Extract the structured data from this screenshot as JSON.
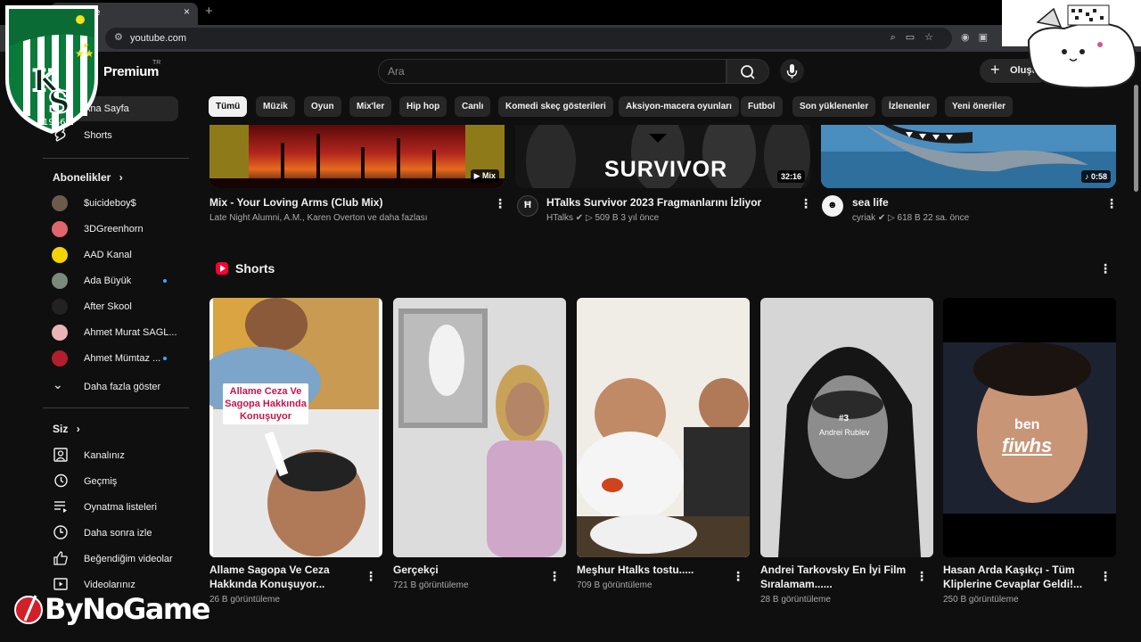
{
  "browser": {
    "tab_title": "ube",
    "tab_close": "×",
    "new_tab": "+",
    "url": "youtube.com",
    "menu": "⋮"
  },
  "header": {
    "brand_suffix": "Premium",
    "brand_tm": "TR",
    "search_placeholder": "Ara",
    "create_label": "Oluştur"
  },
  "sidebar": {
    "home": "Ana Sayfa",
    "shorts": "Shorts",
    "subscriptions_title": "Abonelikler",
    "subscriptions": [
      {
        "label": "$uicideboy$",
        "color": "#6b5b4b",
        "dot": false
      },
      {
        "label": "3DGreenhorn",
        "color": "#e0666e",
        "dot": false
      },
      {
        "label": "AAD Kanal",
        "color": "#f5d300",
        "dot": false
      },
      {
        "label": "Ada Büyük",
        "color": "#7a8a7a",
        "dot": true
      },
      {
        "label": "After Skool",
        "color": "#222222",
        "dot": false
      },
      {
        "label": "Ahmet Murat SAGL...",
        "color": "#e8b4b8",
        "dot": false
      },
      {
        "label": "Ahmet Mümtaz ...",
        "color": "#b21e2b",
        "dot": true
      }
    ],
    "show_more": "Daha fazla göster",
    "you_title": "Siz",
    "you_items": [
      "Kanalınız",
      "Geçmiş",
      "Oynatma listeleri",
      "Daha sonra izle",
      "Beğendiğim videolar",
      "Videolarınız"
    ]
  },
  "chips": [
    "Tümü",
    "Müzik",
    "Oyun",
    "Mix'ler",
    "Hip hop",
    "Canlı",
    "Komedi skeç gösterileri",
    "Aksiyon-macera oyunları",
    "Futbol",
    "Son yüklenenler",
    "İzlenenler",
    "Yeni öneriler"
  ],
  "videos": [
    {
      "title": "Mix - Your Loving Arms (Club Mix)",
      "meta": "Late Night Alumni, A.M., Karen Overton ve daha fazlası",
      "badge": "Mix"
    },
    {
      "title": "HTalks Survivor 2023 Fragmanlarını İzliyor",
      "channel": "HTalks",
      "views": "509 B",
      "age": "3 yıl önce",
      "duration": "32:16",
      "thumb_text": "SURVIVOR"
    },
    {
      "title": "sea life",
      "channel": "cyriak",
      "views": "618 B",
      "age": "22 sa. önce",
      "duration": "0:58"
    }
  ],
  "shorts": {
    "title": "Shorts",
    "items": [
      {
        "title_line1": "Allame Sagopa Ve Ceza",
        "title_line2": "Hakkında Konuşuyor...",
        "views": "26 B görüntüleme",
        "caption": "Allame Ceza Ve Sagopa Hakkında Konuşuyor"
      },
      {
        "title_line1": "Gerçekçi",
        "title_line2": "",
        "views": "721 B görüntüleme"
      },
      {
        "title_line1": "Meşhur Htalks tostu.....",
        "title_line2": "",
        "views": "709 B görüntüleme"
      },
      {
        "title_line1": "Andrei Tarkovsky En İyi Film",
        "title_line2": "Sıralamam......",
        "views": "28 B görüntüleme",
        "overlay_rank": "#3",
        "overlay_name": "Andrei Rublev"
      },
      {
        "title_line1": "Hasan Arda Kaşıkçı - Tüm",
        "title_line2": "Kliplerine Cevaplar Geldi!...",
        "views": "250 B görüntüleme",
        "overlay_line1": "ben",
        "overlay_line2": "fiwhs"
      }
    ]
  },
  "overlays": {
    "club_letters_top": "K",
    "club_letters_bottom": "S",
    "club_year": "1966",
    "watermark": "ByNoGame"
  }
}
